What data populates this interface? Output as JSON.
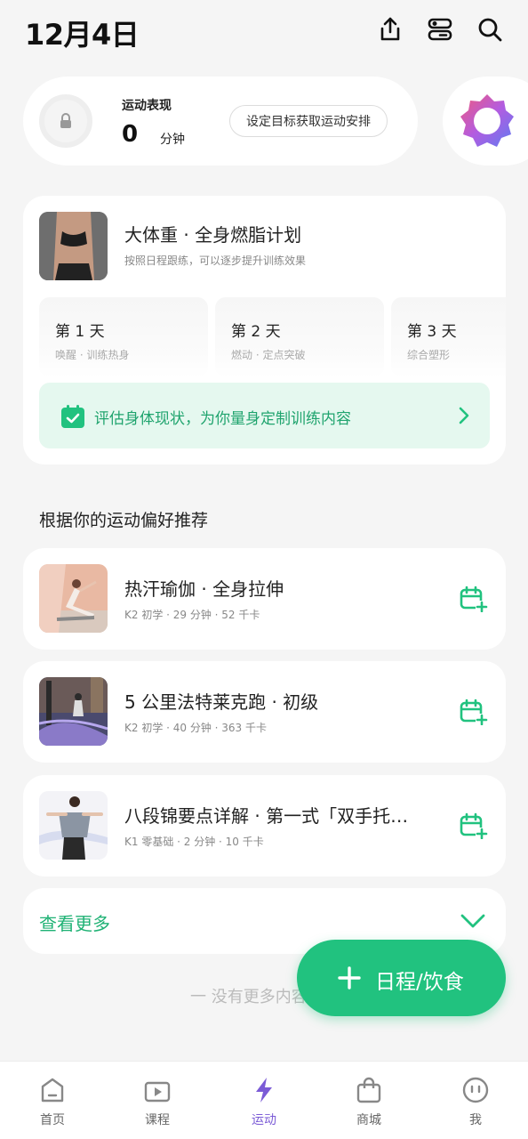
{
  "header": {
    "date": "12月4日"
  },
  "performance": {
    "label": "运动表现",
    "value": "0",
    "unit": "分钟",
    "goal_button": "设定目标获取运动安排"
  },
  "plan": {
    "title": "大体重 · 全身燃脂计划",
    "subtitle": "按照日程跟练，可以逐步提升训练效果",
    "days": [
      {
        "title": "第 1 天",
        "sub": "唤醒 · 训练热身"
      },
      {
        "title": "第 2 天",
        "sub": "燃动 · 定点突破"
      },
      {
        "title": "第 3 天",
        "sub": "综合塑形"
      }
    ],
    "assess_text": "评估身体现状，为你量身定制训练内容"
  },
  "recommend": {
    "section_title": "根据你的运动偏好推荐",
    "items": [
      {
        "title": "热汗瑜伽 · 全身拉伸",
        "meta": "K2 初学 · 29 分钟 · 52 千卡"
      },
      {
        "title": "5 公里法特莱克跑 · 初级",
        "meta": "K2 初学 · 40 分钟 · 363 千卡"
      },
      {
        "title": "八段锦要点详解 · 第一式「双手托…",
        "meta": "K1 零基础 · 2 分钟 · 10 千卡"
      }
    ],
    "more_label": "查看更多",
    "end_text": "一  没有更多内容"
  },
  "fab": {
    "label": "日程/饮食"
  },
  "tabs": [
    {
      "label": "首页",
      "icon": "home-icon"
    },
    {
      "label": "课程",
      "icon": "play-icon"
    },
    {
      "label": "运动",
      "icon": "lightning-icon"
    },
    {
      "label": "商城",
      "icon": "shop-bag-icon"
    },
    {
      "label": "我",
      "icon": "face-icon"
    }
  ],
  "colors": {
    "accent_green": "#21c27f",
    "active_tab": "#7b5bd6",
    "assess_bg": "#e5f8ef"
  }
}
